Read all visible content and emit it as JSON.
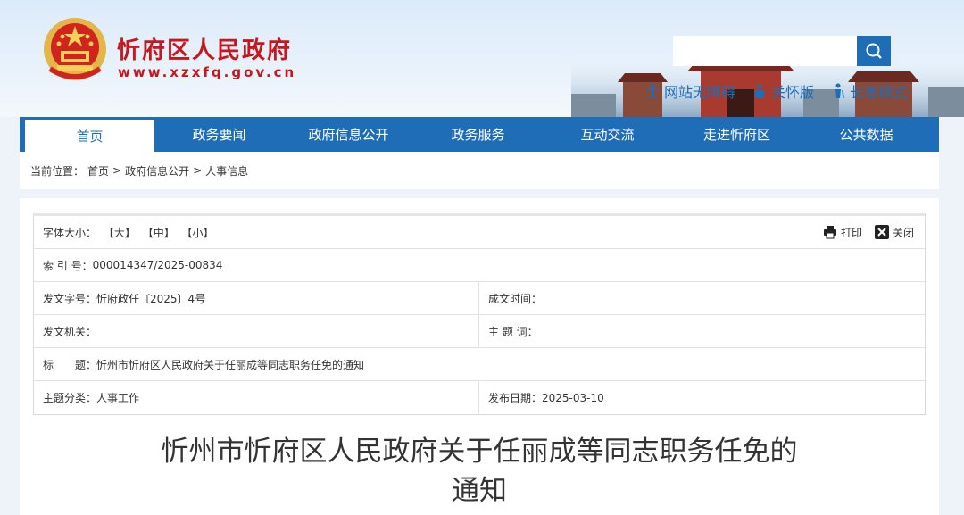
{
  "header": {
    "site_title": "忻府区人民政府",
    "site_url": "www.xzxfq.gov.cn",
    "search_placeholder": "",
    "links": [
      "网站无障碍",
      "关怀版",
      "长者模式"
    ]
  },
  "nav": {
    "items": [
      "首页",
      "政务要闻",
      "政府信息公开",
      "政务服务",
      "互动交流",
      "走进忻府区",
      "公共数据"
    ],
    "active_index": 0
  },
  "breadcrumb": {
    "prefix": "当前位置：",
    "path": [
      "首页",
      ">",
      "政府信息公开",
      ">",
      "人事信息"
    ]
  },
  "info": {
    "font_size_label": "字体大小：",
    "font_sizes": [
      "【大】",
      "【中】",
      "【小】"
    ],
    "print_label": "打印",
    "close_label": "关闭",
    "index_label": "索 引 号：",
    "index_value": "000014347/2025-00834",
    "doc_no_label": "发文字号：",
    "doc_no_value": "忻府政任〔2025〕4号",
    "written_date_label": "成文时间：",
    "written_date_value": "",
    "issuer_label": "发文机关：",
    "issuer_value": "",
    "keywords_label": "主 题 词：",
    "keywords_value": "",
    "title_label": "标　　题：",
    "title_value": "忻州市忻府区人民政府关于任丽成等同志职务任免的通知",
    "category_label": "主题分类：",
    "category_value": "人事工作",
    "publish_date_label": "发布日期：",
    "publish_date_value": "2025-03-10"
  },
  "document": {
    "title_line1": "忻州市忻府区人民政府关于任丽成等同志职务任免的",
    "title_line2": "通知"
  },
  "colors": {
    "brand_red": "#c8161d",
    "nav_blue": "#1e6db6"
  }
}
